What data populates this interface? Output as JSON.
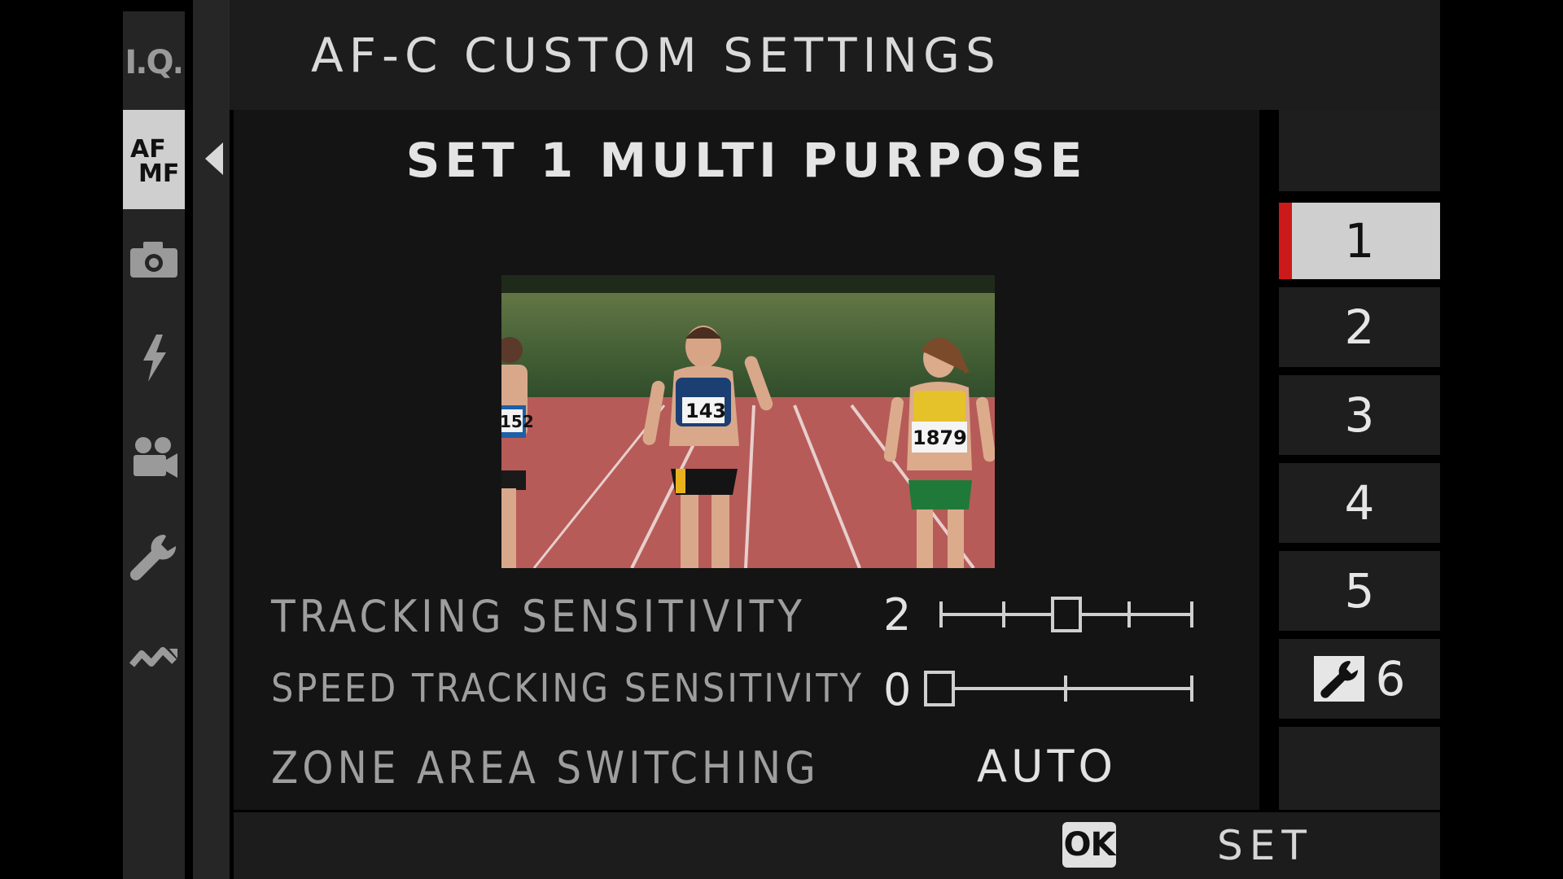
{
  "title": "AF-C CUSTOM SETTINGS",
  "subtitle": "SET 1 MULTI PURPOSE",
  "rail": {
    "items": [
      {
        "name": "iq-icon",
        "text": "I.Q."
      },
      {
        "name": "af-mf-icon",
        "text_top": "AF",
        "text_bottom": "MF",
        "active": true
      },
      {
        "name": "camera-icon"
      },
      {
        "name": "flash-icon"
      },
      {
        "name": "movie-icon"
      },
      {
        "name": "wrench-icon"
      },
      {
        "name": "connection-icon"
      }
    ]
  },
  "settings": {
    "tracking": {
      "label": "TRACKING SENSITIVITY",
      "value": "2",
      "level": 2,
      "max": 4
    },
    "speed": {
      "label": "SPEED TRACKING SENSITIVITY",
      "value": "0",
      "level": 0,
      "max": 2
    },
    "zone": {
      "label": "ZONE AREA SWITCHING",
      "value": "AUTO"
    }
  },
  "photo": {
    "bibs": [
      "152",
      "143",
      "1879"
    ]
  },
  "sets": [
    {
      "label": "1",
      "selected": true
    },
    {
      "label": "2"
    },
    {
      "label": "3"
    },
    {
      "label": "4"
    },
    {
      "label": "5"
    },
    {
      "label": "6",
      "custom_icon": "wrench-icon"
    }
  ],
  "footer": {
    "ok": "OK",
    "set": "SET"
  },
  "colors": {
    "selection": "#cfcfcf",
    "marker": "#cc1a1a",
    "track": "#b75b58"
  }
}
